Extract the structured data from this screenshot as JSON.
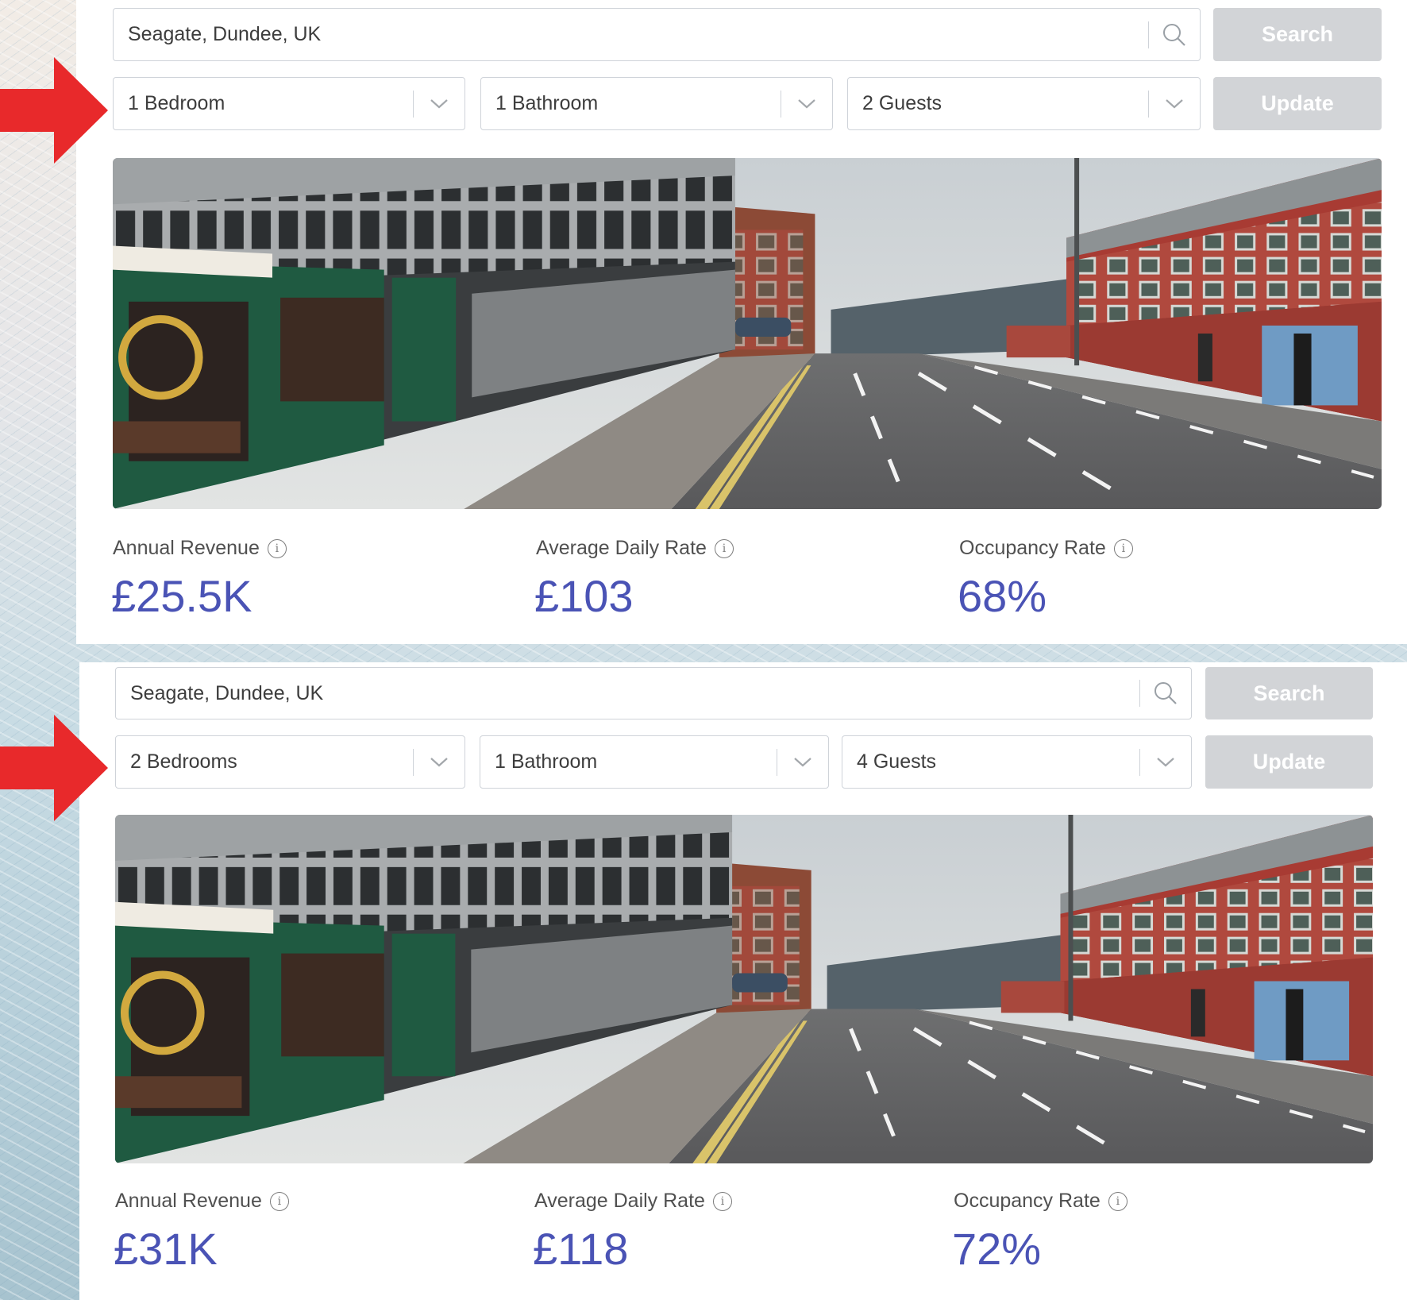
{
  "annotation_color": "#e8292b",
  "accent_color": "#4a53b5",
  "button_color": "#d2d4d7",
  "icons": {
    "search": "search-icon",
    "dropdown": "chevron-down-icon",
    "info": "info-icon",
    "annotation": "arrow-right-icon"
  },
  "top": {
    "search": {
      "location": "Seagate, Dundee, UK",
      "button": "Search"
    },
    "filters": {
      "bedrooms": "1 Bedroom",
      "bathrooms": "1 Bathroom",
      "guests": "2 Guests",
      "button": "Update"
    },
    "stats": {
      "annual_revenue": {
        "label": "Annual Revenue",
        "value": "£25.5K"
      },
      "average_daily_rate": {
        "label": "Average Daily Rate",
        "value": "£103"
      },
      "occupancy_rate": {
        "label": "Occupancy Rate",
        "value": "68%"
      }
    }
  },
  "bottom": {
    "search": {
      "location": "Seagate, Dundee, UK",
      "button": "Search"
    },
    "filters": {
      "bedrooms": "2 Bedrooms",
      "bathrooms": "1 Bathroom",
      "guests": "4 Guests",
      "button": "Update"
    },
    "stats": {
      "annual_revenue": {
        "label": "Annual Revenue",
        "value": "£31K"
      },
      "average_daily_rate": {
        "label": "Average Daily Rate",
        "value": "£118"
      },
      "occupancy_rate": {
        "label": "Occupancy Rate",
        "value": "72%"
      }
    }
  }
}
